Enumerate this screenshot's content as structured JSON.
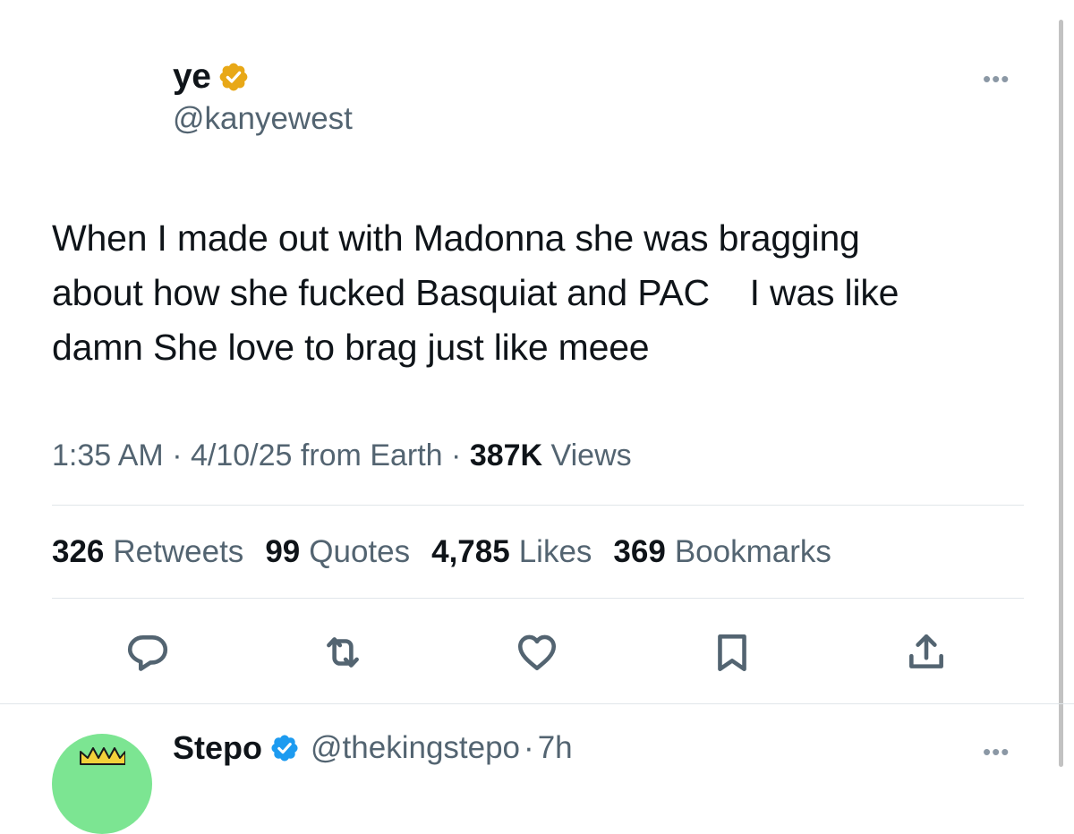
{
  "tweet": {
    "display_name": "ye",
    "handle": "@kanyewest",
    "more_label": "•••",
    "text": "When I made out with Madonna she was bragging\nabout how she fucked Basquiat and PAC    I was like\ndamn She love to brag just like meee",
    "time": "1:35 AM",
    "sep1": " · ",
    "date": "4/10/25",
    "source": " from Earth",
    "sep2": " · ",
    "views_count": "387K",
    "views_label": " Views",
    "badge_color": "#e8a817"
  },
  "stats": [
    {
      "count": "326",
      "label": "Retweets"
    },
    {
      "count": "99",
      "label": "Quotes"
    },
    {
      "count": "4,785",
      "label": "Likes"
    },
    {
      "count": "369",
      "label": "Bookmarks"
    }
  ],
  "actions": [
    {
      "name": "reply-icon"
    },
    {
      "name": "retweet-icon"
    },
    {
      "name": "like-icon"
    },
    {
      "name": "bookmark-icon"
    },
    {
      "name": "share-icon"
    }
  ],
  "reply": {
    "display_name": "Stepo",
    "handle": "@thekingstepo",
    "sep": "·",
    "time": "7h",
    "more_label": "•••",
    "badge_color": "#1d9bf0",
    "avatar_color": "#7ce592"
  }
}
